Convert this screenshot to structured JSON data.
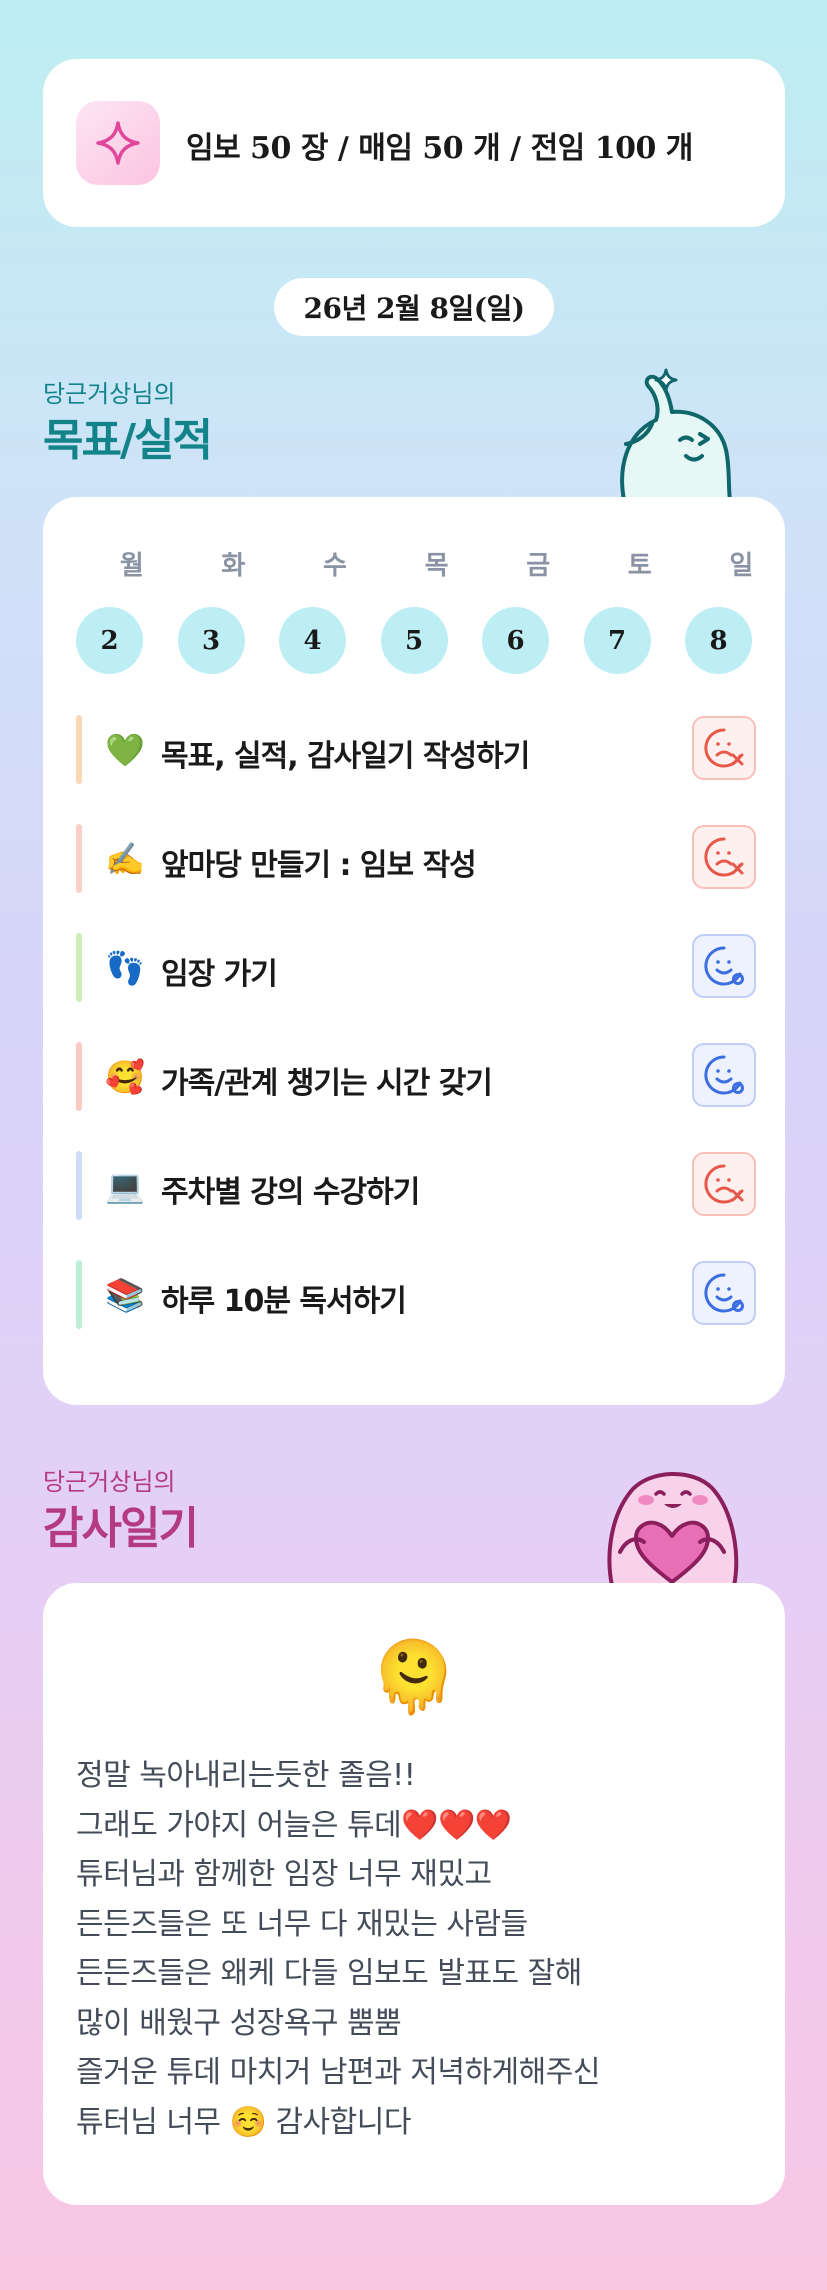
{
  "header": {
    "goal_text": "임보 50 장 / 매임 50 개 / 전임 100 개",
    "icon": "sparkle-icon"
  },
  "date": "26년 2월 8일(일)",
  "goals_section": {
    "subtitle": "당근거상님의",
    "title": "목표/실적",
    "mascot": "waving-mascot"
  },
  "week": {
    "weekdays": [
      "월",
      "화",
      "수",
      "목",
      "금",
      "토",
      "일"
    ],
    "days": [
      "2",
      "3",
      "4",
      "5",
      "6",
      "7",
      "8"
    ]
  },
  "tasks": [
    {
      "emoji": "💚",
      "label": "목표, 실적, 감사일기 작성하기",
      "bar_color": "#fbd7b5",
      "status": "fail",
      "status_icon": "sad-face-x-icon"
    },
    {
      "emoji": "✍️",
      "label": "앞마당 만들기 : 임보 작성",
      "bar_color": "#fbd0c8",
      "status": "fail",
      "status_icon": "sad-face-x-icon"
    },
    {
      "emoji": "👣",
      "label": "임장 가기",
      "bar_color": "#cdeeb6",
      "status": "done",
      "status_icon": "happy-face-o-icon"
    },
    {
      "emoji": "🥰",
      "label": "가족/관계 챙기는 시간 갖기",
      "bar_color": "#fbcbc3",
      "status": "done",
      "status_icon": "happy-face-o-icon"
    },
    {
      "emoji": "💻",
      "label": "주차별 강의 수강하기",
      "bar_color": "#cfdcf7",
      "status": "fail",
      "status_icon": "sad-face-x-icon"
    },
    {
      "emoji": "📚",
      "label": "하루 10분 독서하기",
      "bar_color": "#bdeed6",
      "status": "done",
      "status_icon": "happy-face-o-icon"
    }
  ],
  "diary_section": {
    "subtitle": "당근거상님의",
    "title": "감사일기",
    "mascot": "heart-hugging-mascot"
  },
  "diary": {
    "emoji": "🫠",
    "lines": [
      "정말 녹아내리는듯한 졸음!!",
      "그래도 가야지 어늘은 튜데❤️❤️❤️",
      "튜터님과 함께한 임장 너무 재밌고",
      "든든즈들은 또 너무 다 재밌는 사람들",
      "든든즈들은 왜케 다들 임보도 발표도 잘해",
      "많이 배웠구 성장욕구 뿜뿜",
      "즐거운 튜데 마치거 남편과 저녁하게해주신",
      "튜터님 너무 ☺️ 감사합니다"
    ]
  },
  "colors": {
    "teal_title": "#13838a",
    "pink_title": "#b43a84",
    "fail": "#e8584a",
    "success": "#3b6ee0",
    "day_circle": "#bdeef4"
  }
}
